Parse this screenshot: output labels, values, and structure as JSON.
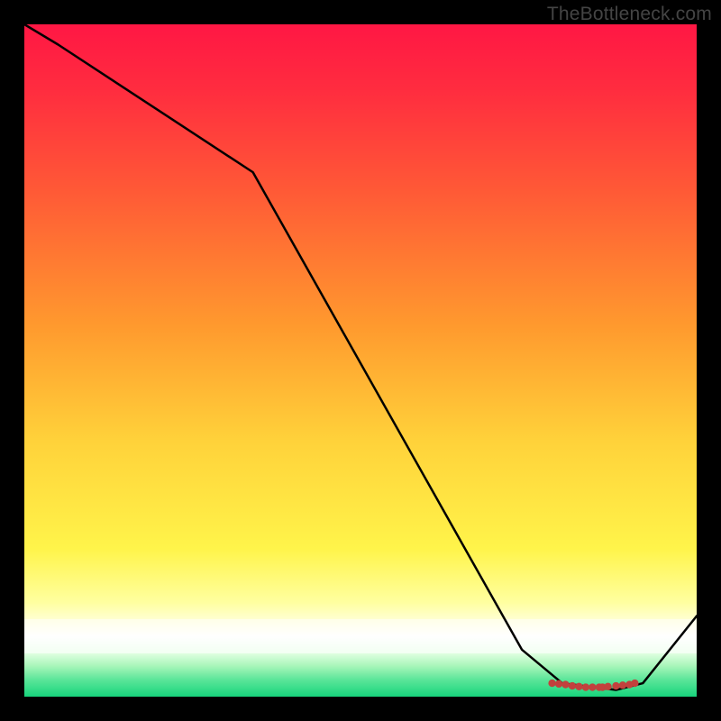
{
  "watermark": "TheBottleneck.com",
  "chart_data": {
    "type": "line",
    "title": "",
    "xlabel": "",
    "ylabel": "",
    "xlim": [
      0,
      100
    ],
    "ylim": [
      0,
      100
    ],
    "x": [
      0,
      5,
      34,
      74,
      80,
      88,
      92,
      100
    ],
    "y": [
      100,
      97,
      78,
      7,
      2,
      1,
      2,
      12
    ],
    "markers": {
      "x": [
        78.5,
        79.5,
        80.5,
        81.5,
        82.5,
        83.5,
        84.5,
        85.5,
        86.0,
        86.8,
        88.0,
        89.0,
        90.0,
        90.8
      ],
      "y": [
        2.0,
        1.9,
        1.8,
        1.6,
        1.5,
        1.4,
        1.4,
        1.4,
        1.4,
        1.5,
        1.6,
        1.7,
        1.8,
        2.0
      ]
    },
    "background": {
      "gradient_stops": [
        {
          "pct": 0.0,
          "color": "#ff1744"
        },
        {
          "pct": 0.1,
          "color": "#ff2d3f"
        },
        {
          "pct": 0.25,
          "color": "#ff5a36"
        },
        {
          "pct": 0.45,
          "color": "#ff9a2e"
        },
        {
          "pct": 0.62,
          "color": "#ffd23a"
        },
        {
          "pct": 0.78,
          "color": "#fff44a"
        },
        {
          "pct": 0.86,
          "color": "#ffffa0"
        },
        {
          "pct": 0.9,
          "color": "#ffffee"
        }
      ],
      "white_band": {
        "top_pct": 0.885,
        "bottom_pct": 0.935
      },
      "green_band": {
        "top_pct": 0.935,
        "bottom_pct": 1.0,
        "stops": [
          {
            "pct": 0.0,
            "color": "#dfffe0"
          },
          {
            "pct": 0.3,
            "color": "#a6f5b8"
          },
          {
            "pct": 0.6,
            "color": "#5de69a"
          },
          {
            "pct": 1.0,
            "color": "#17d47c"
          }
        ]
      }
    },
    "line_color": "#000000",
    "marker_color": "#c2413d"
  }
}
